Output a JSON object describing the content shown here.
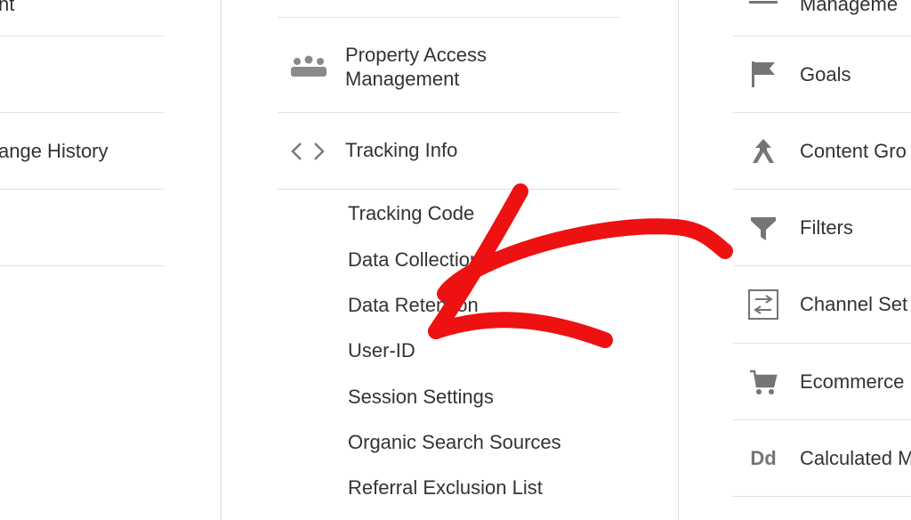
{
  "left_column": {
    "items": [
      {
        "label": "nt"
      },
      {
        "label": "ange History"
      }
    ]
  },
  "middle_column": {
    "items": [
      {
        "label_line1": "Property Access",
        "label_line2": "Management",
        "icon": "people-icon"
      },
      {
        "label": "Tracking Info",
        "icon": "code-brackets-icon"
      }
    ],
    "subitems": [
      "Tracking Code",
      "Data Collection",
      "Data Retention",
      "User-ID",
      "Session Settings",
      "Organic Search Sources",
      "Referral Exclusion List"
    ]
  },
  "right_column": {
    "items": [
      {
        "label": "Manageme",
        "icon": "bar-icon"
      },
      {
        "label": "Goals",
        "icon": "flag-icon"
      },
      {
        "label": "Content Gro",
        "icon": "content-grouping-icon"
      },
      {
        "label": "Filters",
        "icon": "filter-icon"
      },
      {
        "label": "Channel Set",
        "icon": "channel-settings-icon"
      },
      {
        "label": "Ecommerce",
        "icon": "cart-icon"
      },
      {
        "label": "Calculated M",
        "icon": "dd-icon"
      }
    ]
  },
  "overlay": {
    "annotation": "red-arrow",
    "color": "#ee1111"
  },
  "colors": {
    "text": "#333333",
    "icon": "#757575",
    "divider": "#e0e0e0"
  }
}
